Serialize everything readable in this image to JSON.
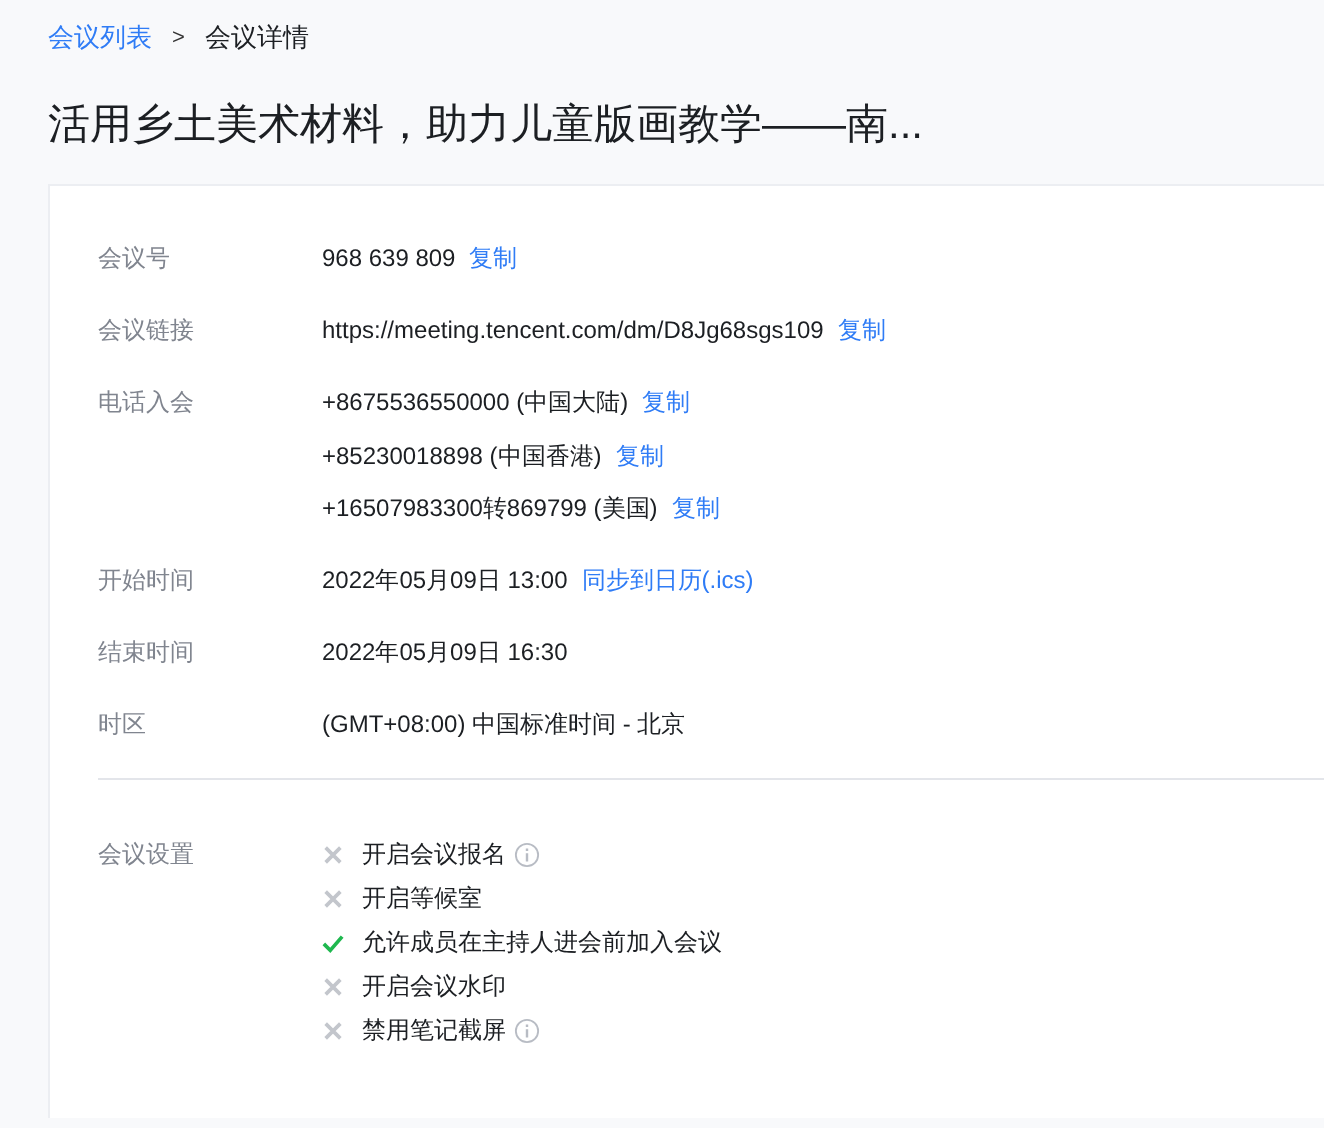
{
  "breadcrumb": [
    {
      "label": "会议列表",
      "link": true
    },
    {
      "label": "会议详情",
      "link": false
    }
  ],
  "breadcrumb_separator": ">",
  "title": "活用乡土美术材料，助力儿童版画教学——南...",
  "details": [
    {
      "label": "会议号",
      "lines": [
        {
          "value": "968 639 809",
          "action": "复制"
        }
      ]
    },
    {
      "label": "会议链接",
      "lines": [
        {
          "value": "https://meeting.tencent.com/dm/D8Jg68sgs109",
          "action": "复制"
        }
      ]
    },
    {
      "label": "电话入会",
      "lines": [
        {
          "value": "+8675536550000 (中国大陆)",
          "action": "复制"
        },
        {
          "value": "+85230018898 (中国香港)",
          "action": "复制"
        },
        {
          "value": "+16507983300转869799 (美国)",
          "action": "复制"
        }
      ]
    },
    {
      "label": "开始时间",
      "lines": [
        {
          "value": "2022年05月09日 13:00",
          "action": "同步到日历(.ics)"
        }
      ]
    },
    {
      "label": "结束时间",
      "lines": [
        {
          "value": "2022年05月09日 16:30"
        }
      ]
    },
    {
      "label": "时区",
      "lines": [
        {
          "value": "(GMT+08:00) 中国标准时间 - 北京"
        }
      ]
    }
  ],
  "settings": {
    "label": "会议设置",
    "items": [
      {
        "label": "开启会议报名",
        "checked": false,
        "info": true
      },
      {
        "label": "开启等候室",
        "checked": false,
        "info": false
      },
      {
        "label": "允许成员在主持人进会前加入会议",
        "checked": true,
        "info": false
      },
      {
        "label": "开启会议水印",
        "checked": false,
        "info": false
      },
      {
        "label": "禁用笔记截屏",
        "checked": false,
        "info": true
      }
    ]
  }
}
